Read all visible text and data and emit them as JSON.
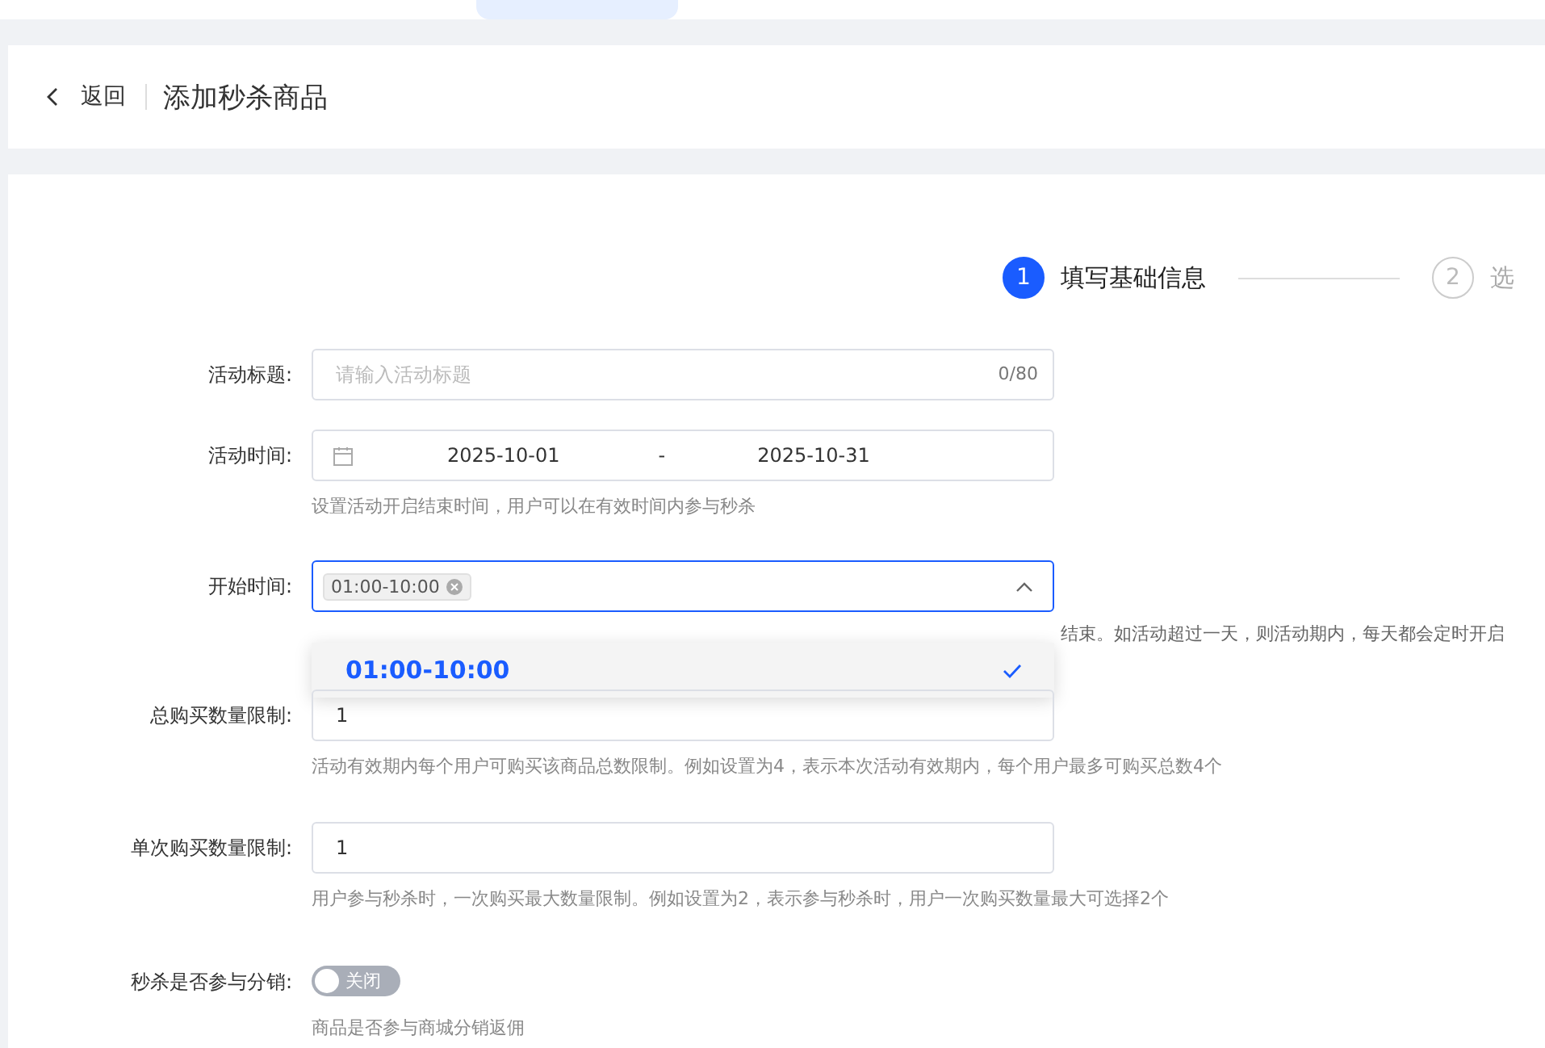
{
  "top_tabs": [
    {
      "selected": true
    }
  ],
  "header": {
    "back": "返回",
    "title": "添加秒杀商品"
  },
  "steps": [
    {
      "number": "1",
      "label": "填写基础信息",
      "selected": true
    },
    {
      "number": "2",
      "label": "选",
      "selected": false
    }
  ],
  "form": {
    "title": {
      "label": "活动标题:",
      "placeholder": "请输入活动标题",
      "count": "0/80"
    },
    "period": {
      "label": "活动时间:",
      "start": "2025-10-01",
      "separator": "-",
      "end": "2025-10-31",
      "hint": "设置活动开启结束时间，用户可以在有效时间内参与秒杀"
    },
    "start_time": {
      "label": "开始时间:",
      "tag": "01:00-10:00",
      "hint": "结束。如活动超过一天，则活动期内，每天都会定时开启",
      "dropdown": [
        {
          "label": "01:00-10:00",
          "selected": true
        }
      ]
    },
    "total_limit": {
      "label": "总购买数量限制:",
      "value": "1",
      "hint": "活动有效期内每个用户可购买该商品总数限制。例如设置为4，表示本次活动有效期内，每个用户最多可购买总数4个"
    },
    "single_limit": {
      "label": "单次购买数量限制:",
      "value": "1",
      "hint": "用户参与秒杀时，一次购买最大数量限制。例如设置为2，表示参与秒杀时，用户一次购买数量最大可选择2个"
    },
    "distribution": {
      "label": "秒杀是否参与分销:",
      "on": false,
      "switch_text": "关闭",
      "hint": "商品是否参与商城分销返佣"
    }
  }
}
